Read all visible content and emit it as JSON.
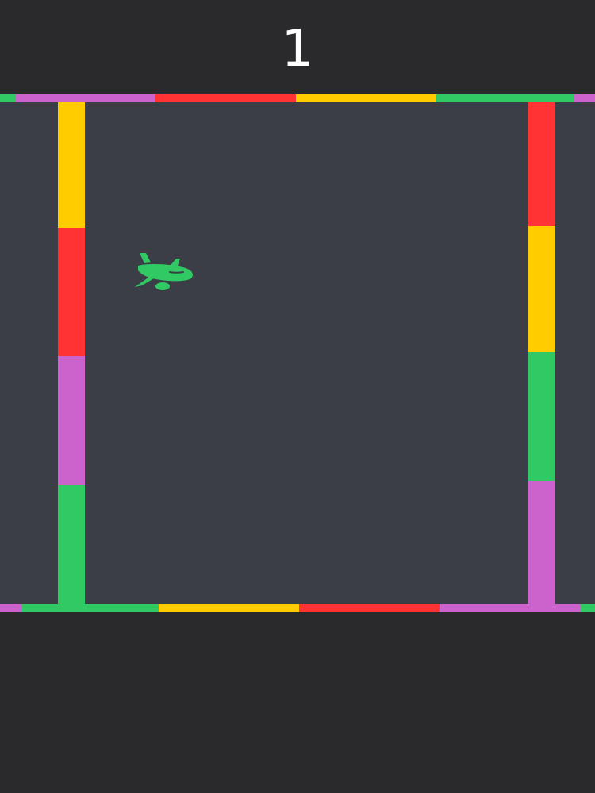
{
  "hud": {
    "score": "1"
  },
  "colors": {
    "background": "#2a292c",
    "play_area": "#3b3e46",
    "green": "#31c964",
    "purple": "#cc63cc",
    "red": "#ff3333",
    "yellow": "#ffcc00",
    "score_text": "#ffffff"
  },
  "player": {
    "icon": "airplane-icon",
    "color": "green"
  },
  "top_strip_colors": [
    "green",
    "purple",
    "red",
    "yellow",
    "green",
    "purple"
  ],
  "bottom_strip_colors": [
    "purple",
    "green",
    "yellow",
    "red",
    "purple",
    "green"
  ],
  "left_wall_colors": [
    "yellow",
    "red",
    "purple",
    "green"
  ],
  "right_wall_colors": [
    "red",
    "yellow",
    "green",
    "purple"
  ]
}
